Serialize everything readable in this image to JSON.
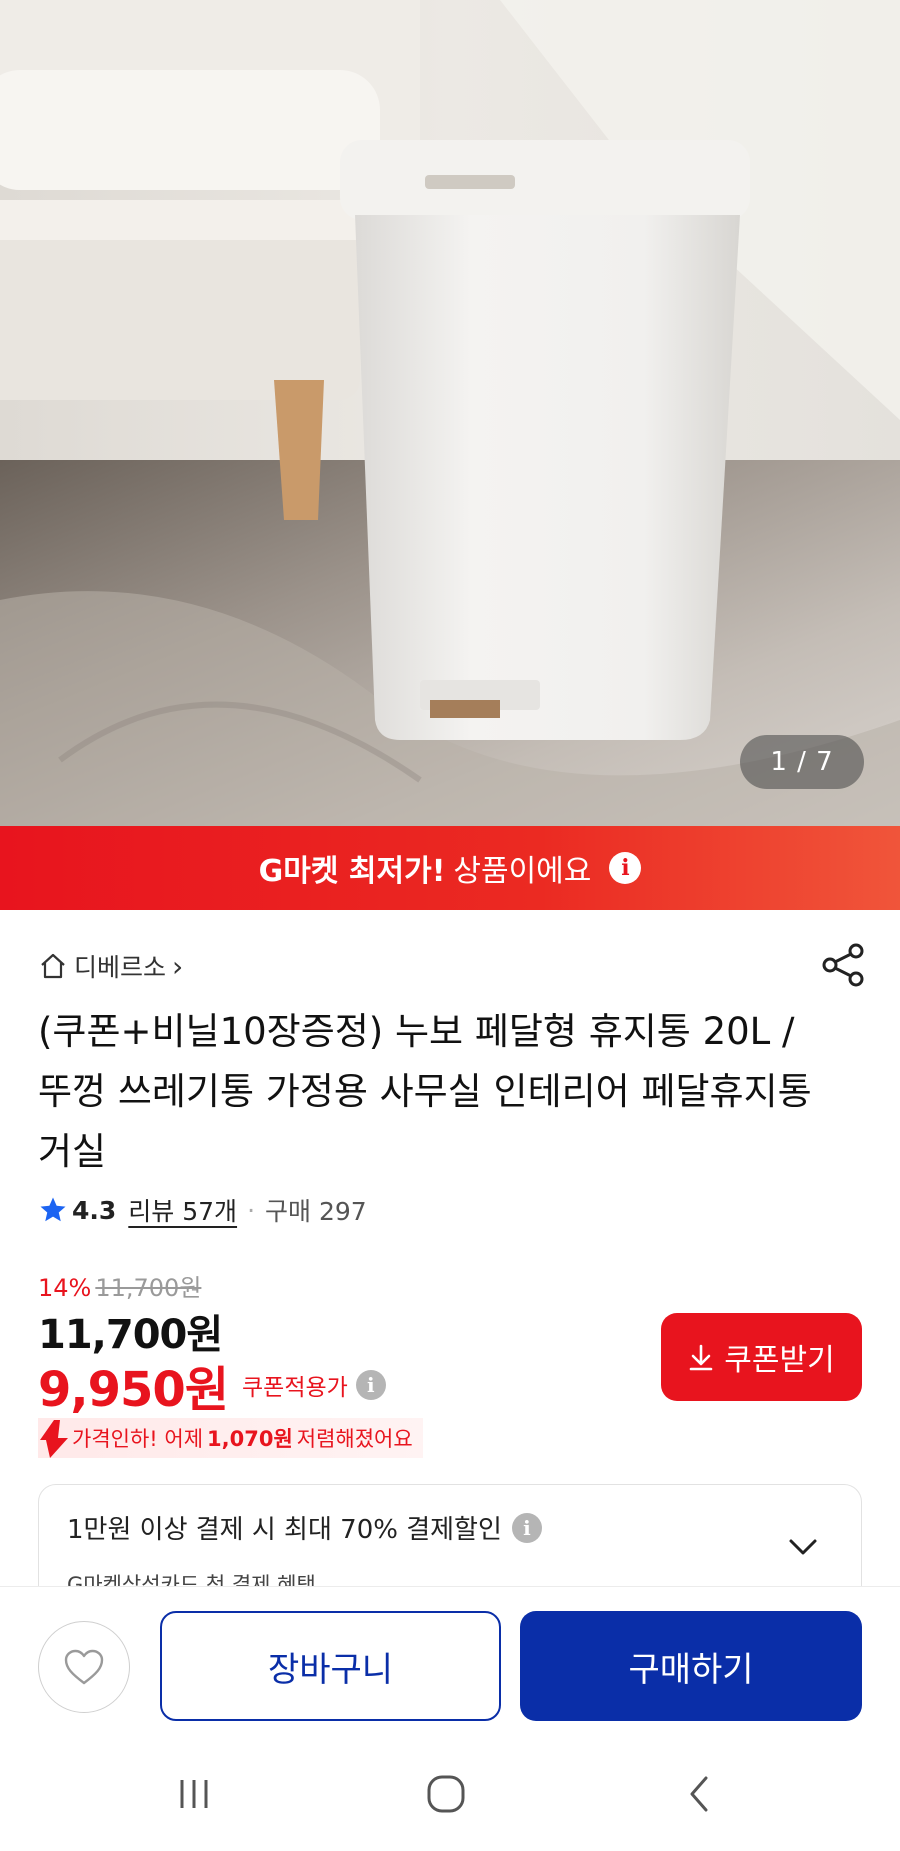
{
  "gallery": {
    "counter": "1 / 7"
  },
  "promo": {
    "bold_text": "G마켓 최저가!",
    "text": "상품이에요",
    "info_symbol": "i",
    "bg_color": "#e8141e"
  },
  "store": {
    "name": "디베르소",
    "chevron": "›"
  },
  "product": {
    "title": "(쿠폰+비닐10장증정) 누보 페달형 휴지통 20L / 뚜껑 쓰레기통 가정용 사무실 인테리어 페달휴지통 거실"
  },
  "rating": {
    "score": "4.3",
    "reviews": "리뷰 57개",
    "separator": "·",
    "purchases": "구매 297",
    "star_color": "#1c64f2"
  },
  "pricing": {
    "discount_rate": "14%",
    "original_price": "11,700원",
    "price": "11,700원",
    "coupon_price": "9,950원",
    "coupon_label": "쿠폰적용가",
    "coupon_help_symbol": "i",
    "drop_prefix": "가격인하! 어제",
    "drop_amount": "1,070원",
    "drop_suffix": "저렴해졌어요",
    "accent_color": "#e8141e"
  },
  "coupon_button": {
    "label": "쿠폰받기",
    "icon": "download-arrow-icon"
  },
  "payment_benefit": {
    "headline": "1만원 이상 결제 시 최대 70% 결제할인",
    "help_symbol": "i",
    "subtext": "G마켓삼성카드 첫 결제 혜택"
  },
  "actions": {
    "cart_label": "장바구니",
    "buy_label": "구매하기",
    "primary_color": "#0a2ea8"
  },
  "system_nav": {
    "icons": [
      "recent-apps-icon",
      "home-icon",
      "back-icon"
    ]
  }
}
